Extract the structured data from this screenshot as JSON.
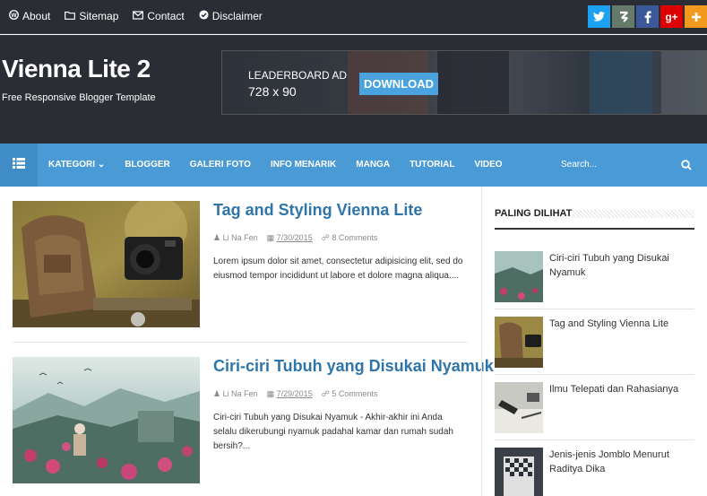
{
  "topbar": {
    "links": [
      {
        "label": "About",
        "icon": "wordpress-icon"
      },
      {
        "label": "Sitemap",
        "icon": "folder-icon"
      },
      {
        "label": "Contact",
        "icon": "envelope-icon"
      },
      {
        "label": "Disclaimer",
        "icon": "check-circle-icon"
      }
    ],
    "socials": [
      {
        "glyph": "t",
        "icon": "twitter-icon",
        "color": "#1da1f2"
      },
      {
        "glyph": "s",
        "icon": "stumbleupon-icon",
        "color": "#657a6a"
      },
      {
        "glyph": "f",
        "icon": "facebook-icon",
        "color": "#3b5998"
      },
      {
        "glyph": "g+",
        "icon": "google-plus-icon",
        "color": "#dd0000"
      },
      {
        "glyph": "+",
        "icon": "addthis-icon",
        "color": "#f29a1d"
      }
    ]
  },
  "header": {
    "title": "Vienna Lite 2",
    "tagline": "Free Responsive Blogger Template",
    "ad": {
      "label": "LEADERBOARD AD",
      "size": "728 x 90",
      "button": "DOWNLOAD"
    }
  },
  "nav": {
    "items": [
      "KATEGORI",
      "BLOGGER",
      "GALERI FOTO",
      "INFO MENARIK",
      "MANGA",
      "TUTORIAL",
      "VIDEO"
    ],
    "search_placeholder": "Search...",
    "accent": "#4a9ad6"
  },
  "posts": [
    {
      "title": "Tag and Styling Vienna Lite",
      "author": "Li Na Fen",
      "date": "7/30/2015",
      "comments": "8 Comments",
      "excerpt": "Lorem ipsum dolor sit amet, consectetur adipisicing elit, sed do eiusmod tempor incididunt ut labore et dolore magna aliqua...."
    },
    {
      "title": "Ciri-ciri Tubuh yang Disukai Nyamuk",
      "author": "Li Na Fen",
      "date": "7/29/2015",
      "comments": "5 Comments",
      "excerpt": "Ciri-ciri Tubuh yang Disukai Nyamuk - Akhir-akhir ini Anda selalu dikerubungi nyamuk padahal kamar dan rumah sudah bersih?..."
    }
  ],
  "sidebar": {
    "title": "PALING DILIHAT",
    "items": [
      {
        "label": "Ciri-ciri Tubuh yang Disukai Nyamuk"
      },
      {
        "label": "Tag and Styling Vienna Lite"
      },
      {
        "label": "Ilmu Telepati dan Rahasianya"
      },
      {
        "label": "Jenis-jenis Jomblo Menurut Raditya Dika"
      }
    ]
  }
}
